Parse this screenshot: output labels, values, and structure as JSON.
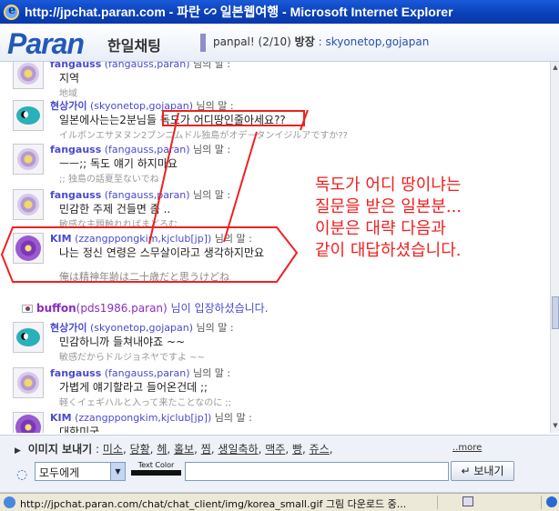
{
  "window": {
    "title": "http://jpchat.paran.com - 파란 ∽ 일본웹여행 - Microsoft Internet Explorer"
  },
  "header": {
    "logo": "Paran",
    "service": "한일채팅",
    "room_name": "panpal!",
    "room_count": "(2/10)",
    "owner_label": "방장",
    "owners": ": skyonetop,gojapan"
  },
  "chat": {
    "messages": [
      {
        "nick": "fangauss",
        "uid": "(fangauss,paran)",
        "suffix": "님의 말 :",
        "text": "지역",
        "translation": "地域",
        "avatar": "flower-icon"
      },
      {
        "nick": "현상가이",
        "uid": "(skyonetop,gojapan)",
        "suffix": "님의 말 :",
        "text": "일본에사는는2분님들 독도가 어디땅인줄아세요??",
        "translation": "イルボンエサヌヌン2ブンニムドル独島がオデ－タンイジルアですか??",
        "avatar": "fish-icon"
      },
      {
        "nick": "fangauss",
        "uid": "(fangauss,paran)",
        "suffix": "님의 말 :",
        "text": "ㅡㅡ;; 독도 얘기 하지마요",
        "translation": ";; 独島の話夏至ないでね",
        "avatar": "flower-icon"
      },
      {
        "nick": "fangauss",
        "uid": "(fangauss,paran)",
        "suffix": "님의 말 :",
        "text": "민감한 주제 건들면 좀 ..",
        "translation": "敏感な主題触れればまどろむ ..",
        "avatar": "flower-icon"
      },
      {
        "nick": "KIM",
        "uid": "(zzangppongkim,kjclub[jp])",
        "suffix": "님의 말 :",
        "text": "나는 정신 연령은 스무살이라고 생각하지만요",
        "translation": "俺は精神年齢は二十歳だと思うけどね",
        "avatar": "purple-flower-icon"
      },
      {
        "nick": "현상가이",
        "uid": "(skyonetop,gojapan)",
        "suffix": "님의 말 :",
        "text": "민감하니까 들쳐내야죠 ~~",
        "translation": "敏感だからドルジョネヤですよ ~~",
        "avatar": "fish-icon"
      },
      {
        "nick": "fangauss",
        "uid": "(fangauss,paran)",
        "suffix": "님의 말 :",
        "text": "가볍게 얘기할라고 들어온건데 ;;",
        "translation": "軽くイェギハルと入って来たことなのに ;;",
        "avatar": "flower-icon"
      },
      {
        "nick": "KIM",
        "uid": "(zzangppongkim,kjclub[jp])",
        "suffix": "님의 말 :",
        "text": "대한미국",
        "translation": "",
        "avatar": "purple-flower-icon"
      }
    ],
    "join_notice": {
      "nick": "buffon",
      "uid": "(pds1986.paran)",
      "text": "님이 입장하셨습니다."
    }
  },
  "annotation": {
    "lines": [
      "독도가 어디 땅이냐는",
      "질문을 받은 일본분...",
      "이분은 대략 다음과",
      "같이 대답하셨습니다."
    ],
    "color": "#f02020"
  },
  "emoticons": {
    "label": "이미지 보내기",
    "items": [
      "미소",
      "당황",
      "헤",
      "홀보",
      "찜",
      "생일축하",
      "맥주",
      "빵",
      "쥬스"
    ],
    "more": "..more"
  },
  "input": {
    "target": "모두에게",
    "text_color_label": "Text Color",
    "text_color": "#111111",
    "send_label": "보내기"
  },
  "status": {
    "text": "http://jpchat.paran.com/chat/chat_client/img/korea_small.gif 그림 다운로드 중..."
  }
}
